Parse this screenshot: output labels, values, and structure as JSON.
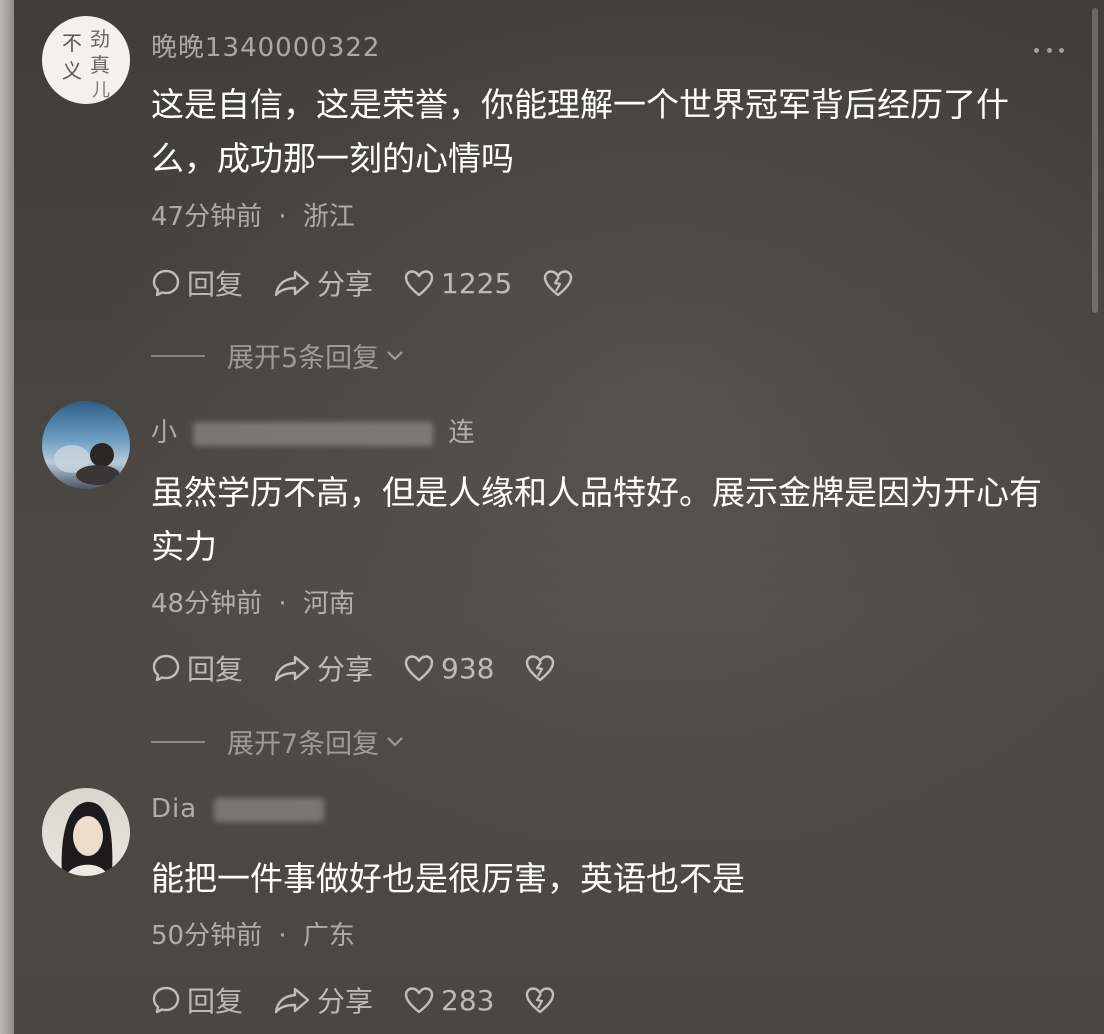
{
  "comments": [
    {
      "username": "晚晚1340000322",
      "text_lines": [
        "这是自信，这是荣誉，你能理解一个世界冠军背后经历了什",
        "么，成功那一刻的心情吗"
      ],
      "time": "47分钟前",
      "region": "浙江",
      "reply_label": "回复",
      "share_label": "分享",
      "likes": "1225",
      "expand_label": "展开5条回复"
    },
    {
      "username": "小",
      "username_tail": "连",
      "text_lines": [
        "虽然学历不高，但是人缘和人品特好。展示金牌是因为开心有",
        "实力"
      ],
      "time": "48分钟前",
      "region": "河南",
      "reply_label": "回复",
      "share_label": "分享",
      "likes": "938",
      "expand_label": "展开7条回复"
    },
    {
      "username": "Dia",
      "text_lines": [
        "能把一件事做好也是很厉害，英语也不是​"
      ],
      "time": "50分钟前",
      "region": "广东",
      "reply_label": "回复",
      "share_label": "分享",
      "likes": "283"
    }
  ],
  "meta_separator": "·",
  "avatar1_calligraphy": [
    "不",
    "义",
    "劲",
    "真",
    "儿"
  ]
}
